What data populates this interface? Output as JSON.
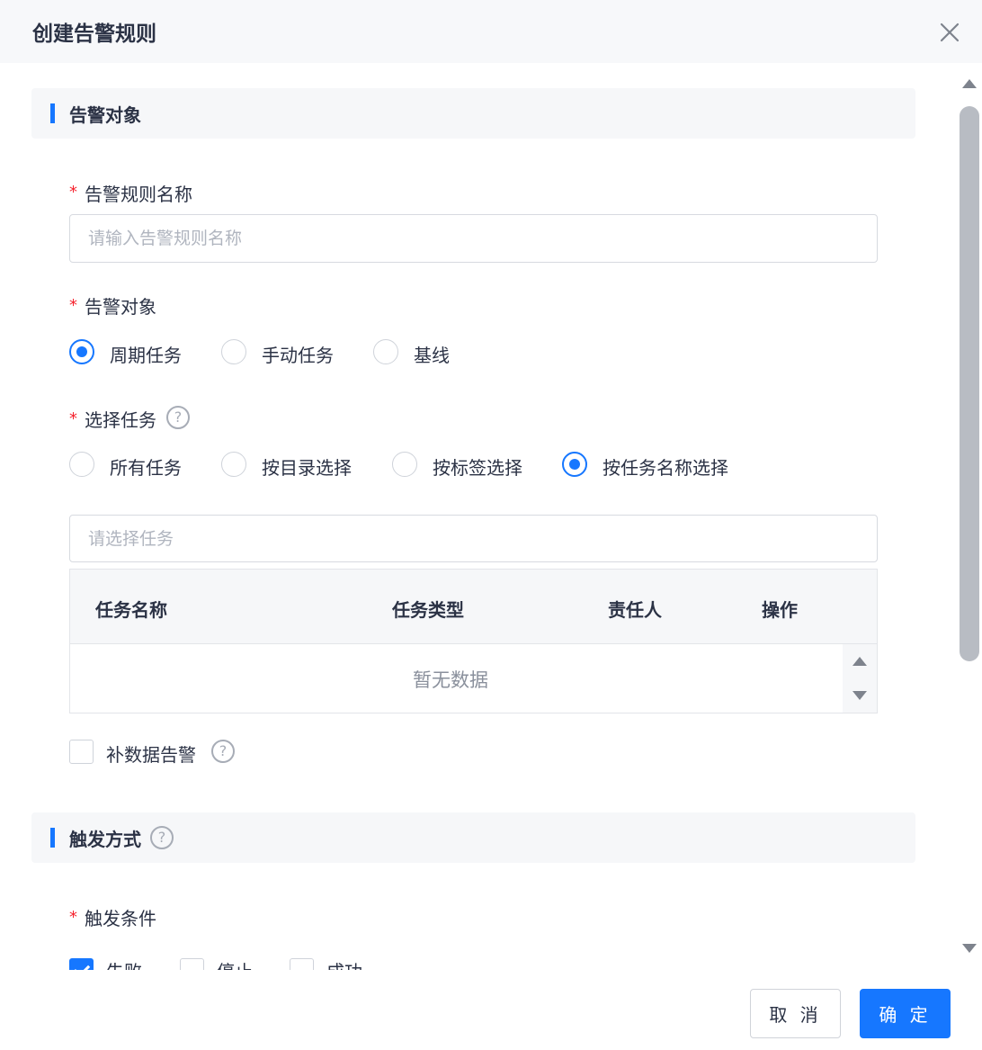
{
  "dialog": {
    "title": "创建告警规则"
  },
  "section_target": {
    "title": "告警对象"
  },
  "rule_name": {
    "label": "告警规则名称",
    "placeholder": "请输入告警规则名称"
  },
  "alert_object": {
    "label": "告警对象",
    "options": [
      "周期任务",
      "手动任务",
      "基线"
    ],
    "selected": "周期任务"
  },
  "task_select": {
    "label": "选择任务",
    "options": [
      "所有任务",
      "按目录选择",
      "按标签选择",
      "按任务名称选择"
    ],
    "selected": "按任务名称选择",
    "placeholder": "请选择任务"
  },
  "task_table": {
    "columns": [
      "任务名称",
      "任务类型",
      "责任人",
      "操作"
    ],
    "rows": [],
    "empty_text": "暂无数据"
  },
  "backfill": {
    "label": "补数据告警",
    "checked": false
  },
  "section_trigger": {
    "title": "触发方式"
  },
  "trigger_condition": {
    "label": "触发条件",
    "options": [
      {
        "label": "失败",
        "checked": true
      },
      {
        "label": "停止",
        "checked": false
      },
      {
        "label": "成功",
        "checked": false
      }
    ]
  },
  "footer": {
    "cancel_label": "取 消",
    "ok_label": "确 定"
  },
  "colors": {
    "primary": "#1677ff",
    "required": "#f5222d",
    "text": "#2b3245"
  },
  "icons": [
    "close-icon",
    "help-icon",
    "scroll-up-icon",
    "scroll-down-icon"
  ]
}
